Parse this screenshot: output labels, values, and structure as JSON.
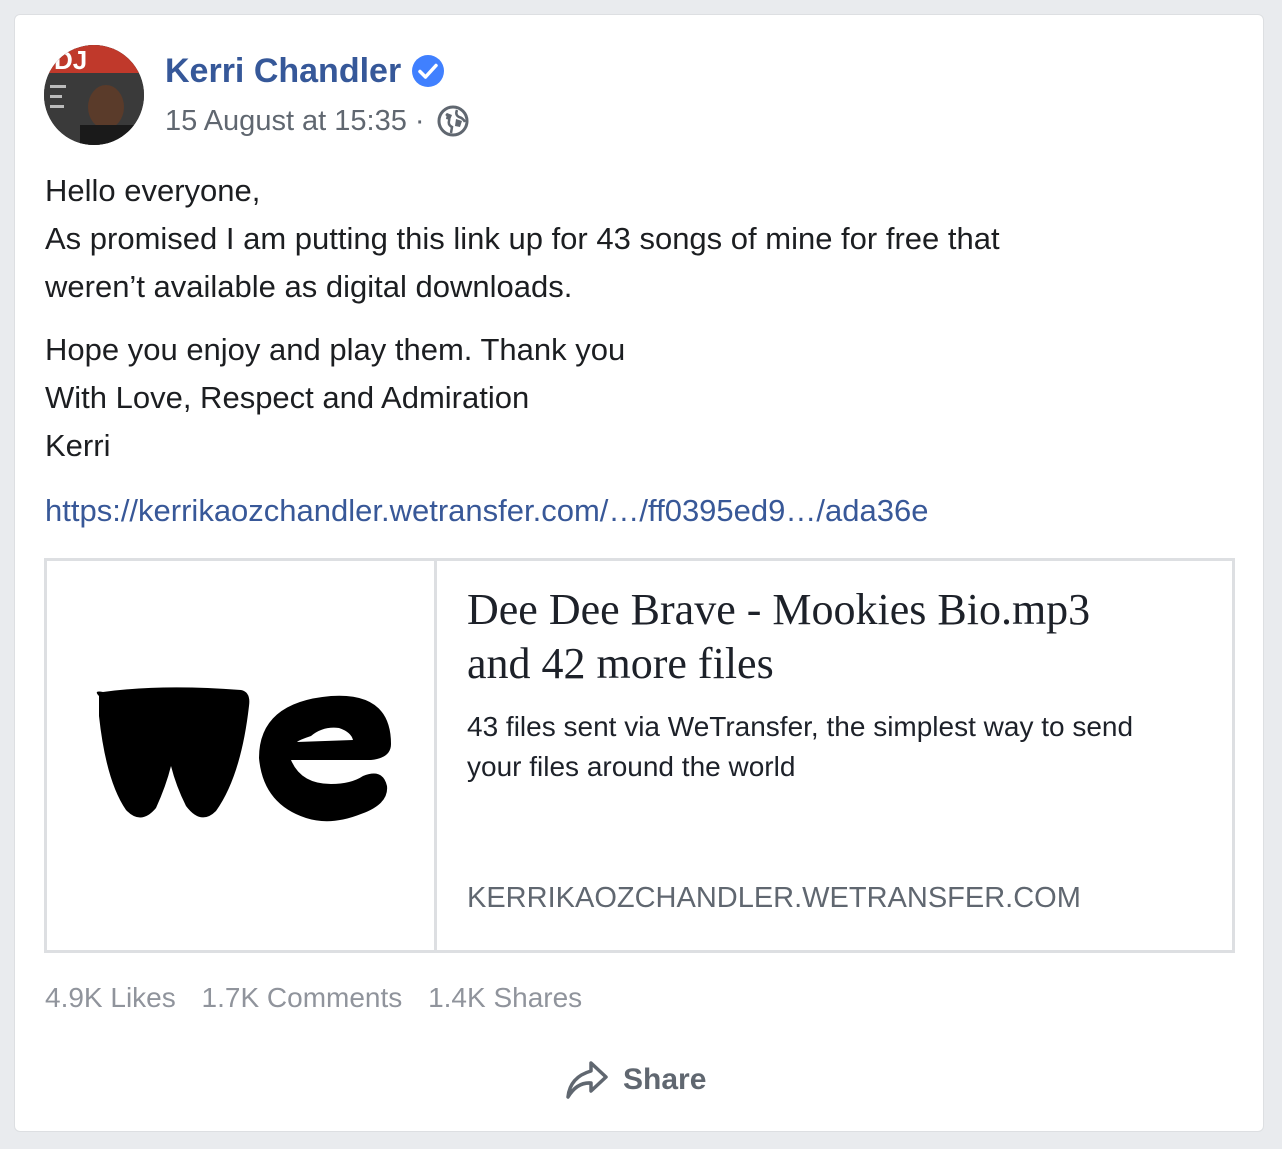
{
  "post": {
    "author": "Kerri Chandler",
    "timestamp": "15 August at 15:35",
    "separator": "·",
    "paragraphs": [
      [
        "Hello everyone,",
        "As promised I am putting this link up for 43 songs of mine for free that",
        "weren’t available as digital downloads."
      ],
      [
        "Hope you enjoy and play them. Thank you",
        "With Love, Respect and Admiration",
        "Kerri"
      ]
    ],
    "link": "https://kerrikaozchandler.wetransfer.com/…/ff0395ed9…/ada36e"
  },
  "preview": {
    "title_line1": "Dee Dee Brave - Mookies Bio.mp3",
    "title_line2": "and 42 more files",
    "desc_line1": "43 files sent via WeTransfer, the simplest way to send",
    "desc_line2": "your files around the world",
    "domain": "KERRIKAOZCHANDLER.WETRANSFER.COM",
    "logo_text": "we"
  },
  "stats": {
    "likes": "4.9K Likes",
    "comments": "1.7K Comments",
    "shares": "1.4K Shares"
  },
  "actions": {
    "share_label": "Share"
  },
  "colors": {
    "author_blue": "#365899",
    "link_blue": "#385898",
    "verified_blue": "#4080ff",
    "meta_gray": "#606770"
  },
  "icons": [
    "verified-badge-icon",
    "globe-icon",
    "share-arrow-icon"
  ]
}
